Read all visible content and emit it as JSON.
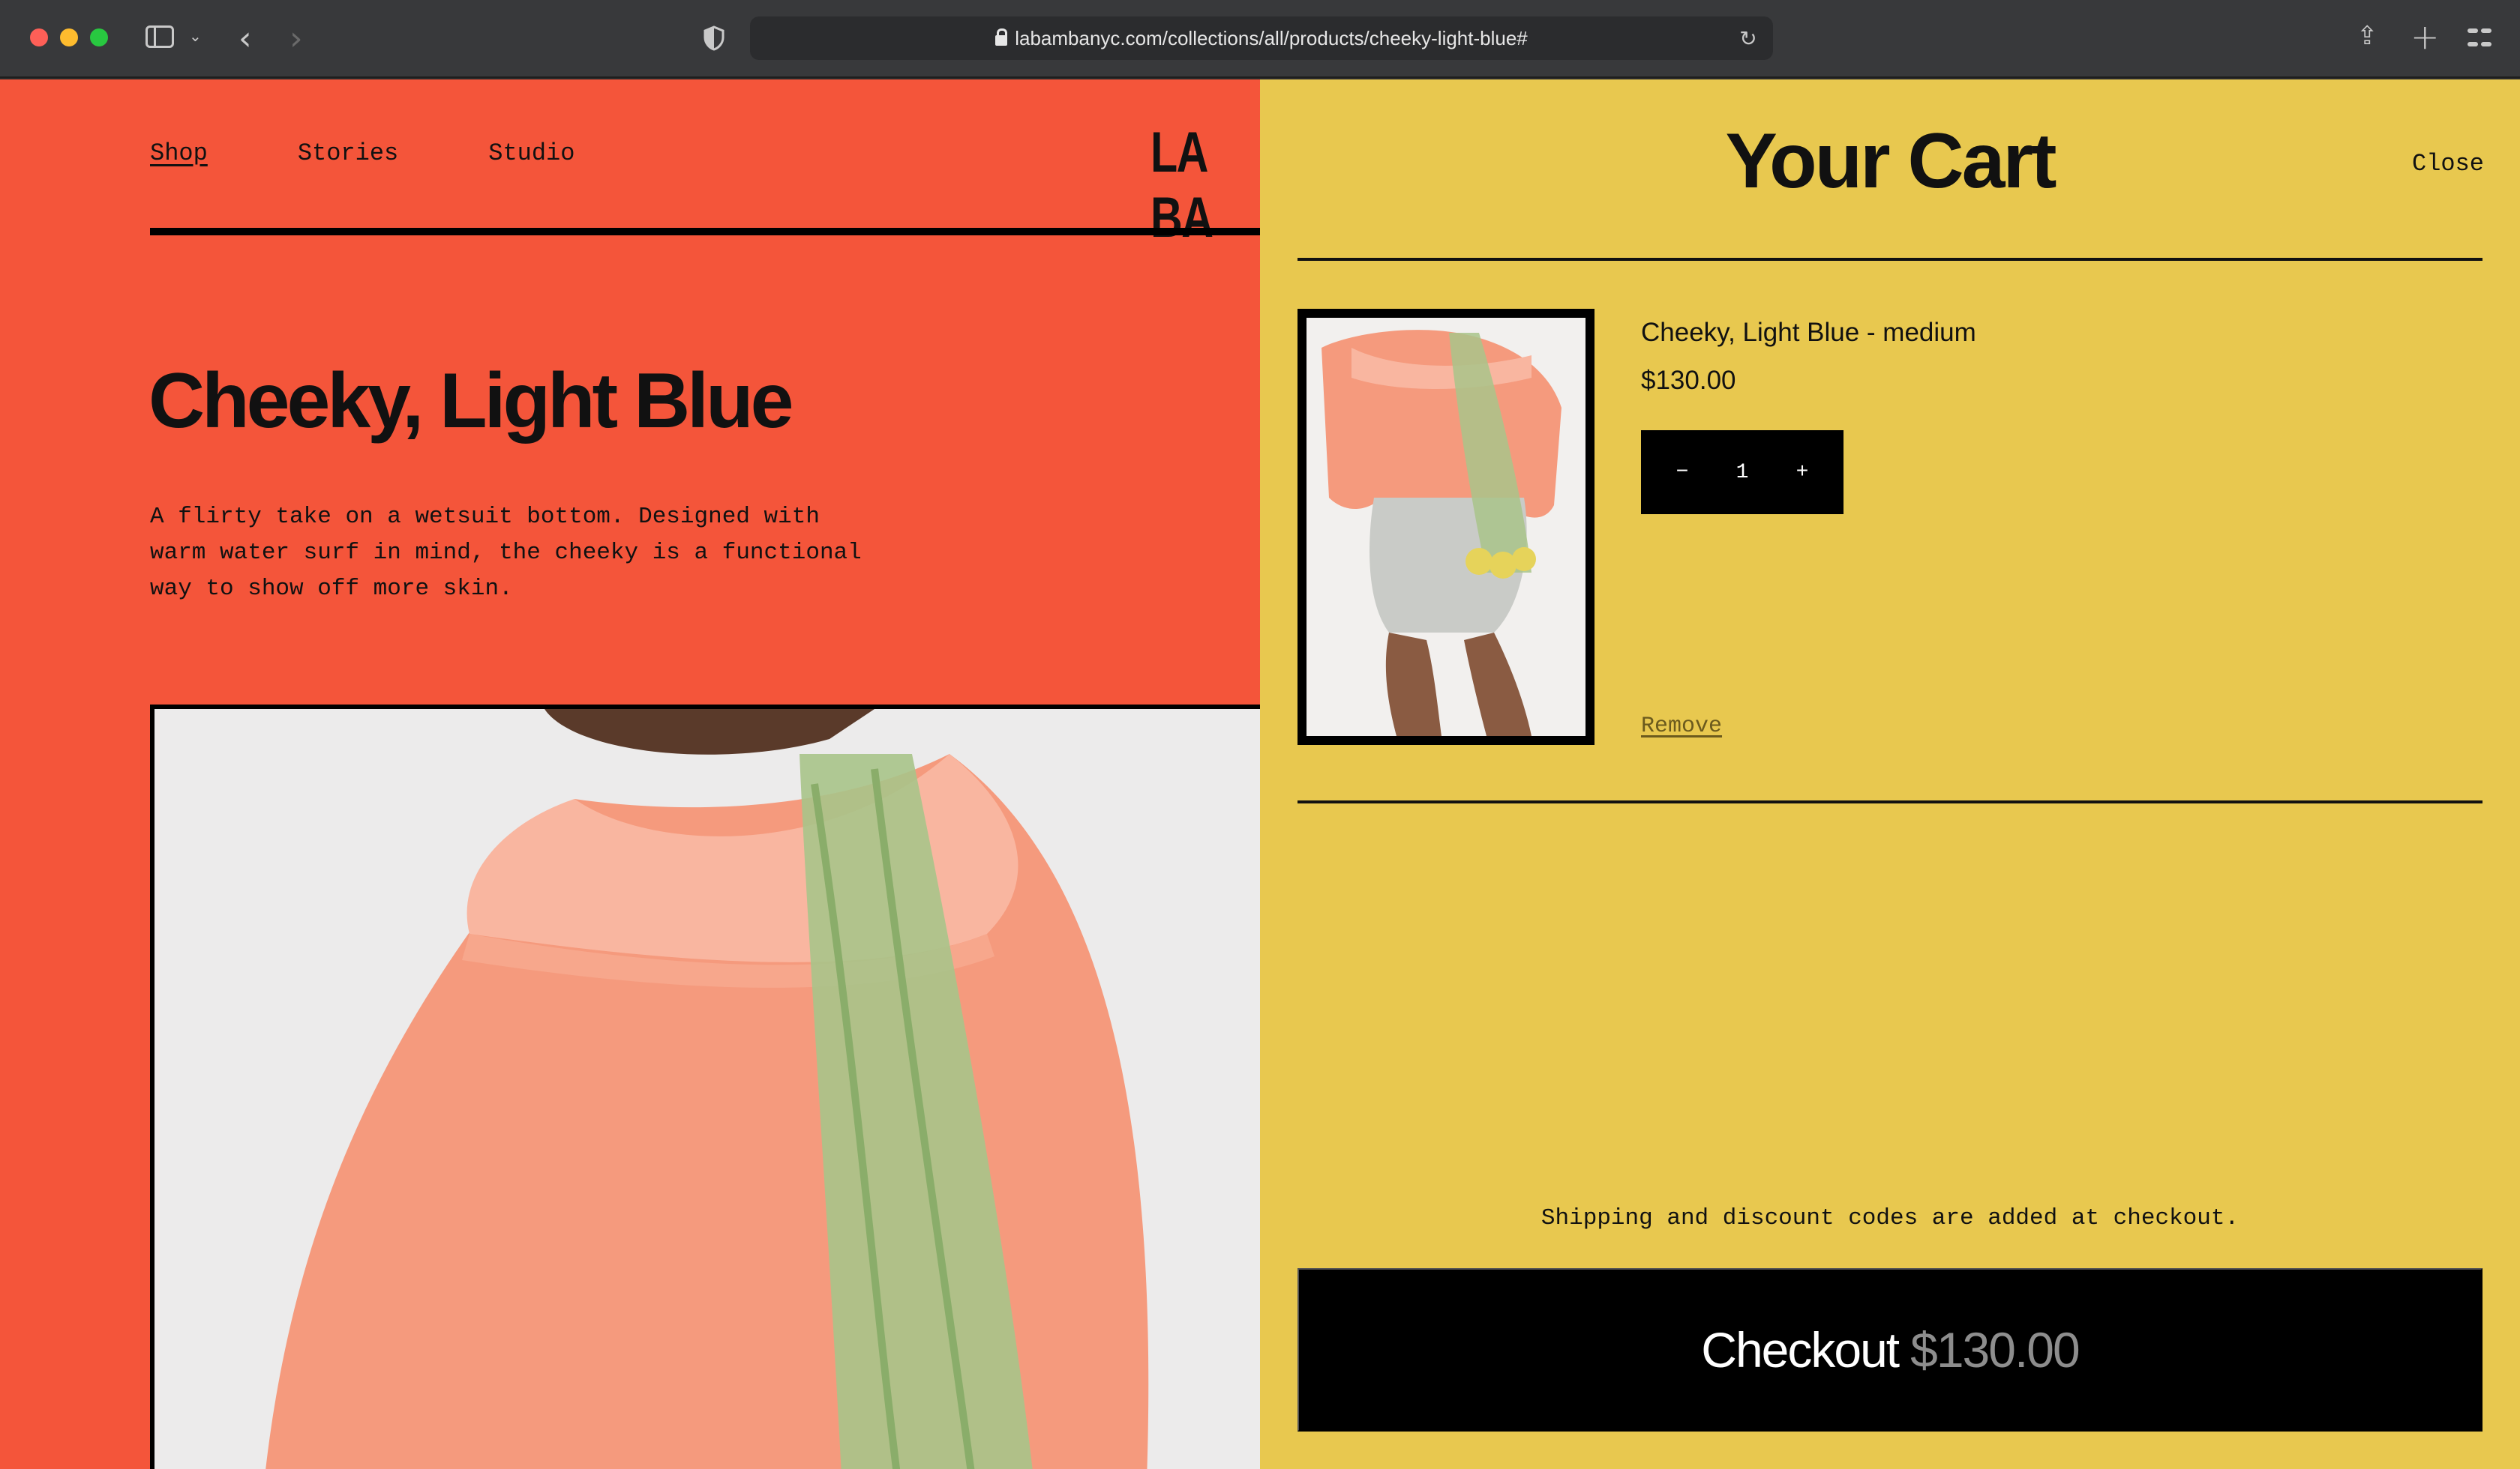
{
  "browser": {
    "url": "labambanyc.com/collections/all/products/cheeky-light-blue#"
  },
  "site": {
    "nav": [
      {
        "label": "Shop",
        "active": true
      },
      {
        "label": "Stories",
        "active": false
      },
      {
        "label": "Studio",
        "active": false
      }
    ],
    "logo_text": "LA BA"
  },
  "product": {
    "title": "Cheeky, Light Blue",
    "description": "A flirty take on a wetsuit bottom. Designed with warm water surf in mind, the cheeky is a functional way to show off more skin."
  },
  "cart": {
    "title": "Your Cart",
    "close_label": "Close",
    "items": [
      {
        "name": "Cheeky, Light Blue - medium",
        "price": "$130.00",
        "quantity": "1",
        "decrement_label": "−",
        "increment_label": "+",
        "remove_label": "Remove"
      }
    ],
    "shipping_note": "Shipping and discount codes are added at checkout.",
    "checkout_label": "Checkout",
    "checkout_total": "$130.00"
  },
  "colors": {
    "page_background": "#f4553a",
    "drawer_background": "#e8c84f",
    "button_background": "#000000"
  }
}
